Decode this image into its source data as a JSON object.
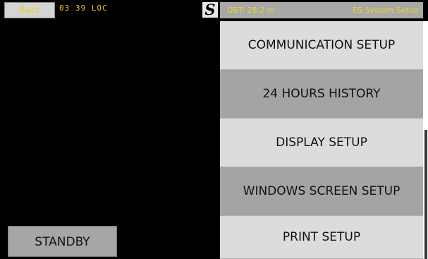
{
  "topbar": {
    "back_label": "Back",
    "clock": "03 39 LOC",
    "logo_text": "S"
  },
  "info": {
    "dbt": "DBT: 28.2 m",
    "title": "ES System Setup"
  },
  "menu": {
    "items": [
      {
        "label": "COMMUNICATION SETUP"
      },
      {
        "label": "24 HOURS HISTORY"
      },
      {
        "label": "DISPLAY SETUP"
      },
      {
        "label": "WINDOWS SCREEN SETUP"
      },
      {
        "label": "PRINT SETUP"
      }
    ]
  },
  "standby": {
    "label": "STANDBY"
  },
  "colors": {
    "background": "#000000",
    "accent_text": "#e8d22a",
    "menu_light": "#dcdcdc",
    "menu_dark": "#a4a4a4",
    "info_bar": "#a8a8a8"
  },
  "icons": {
    "logo": "simrad-s-logo"
  }
}
